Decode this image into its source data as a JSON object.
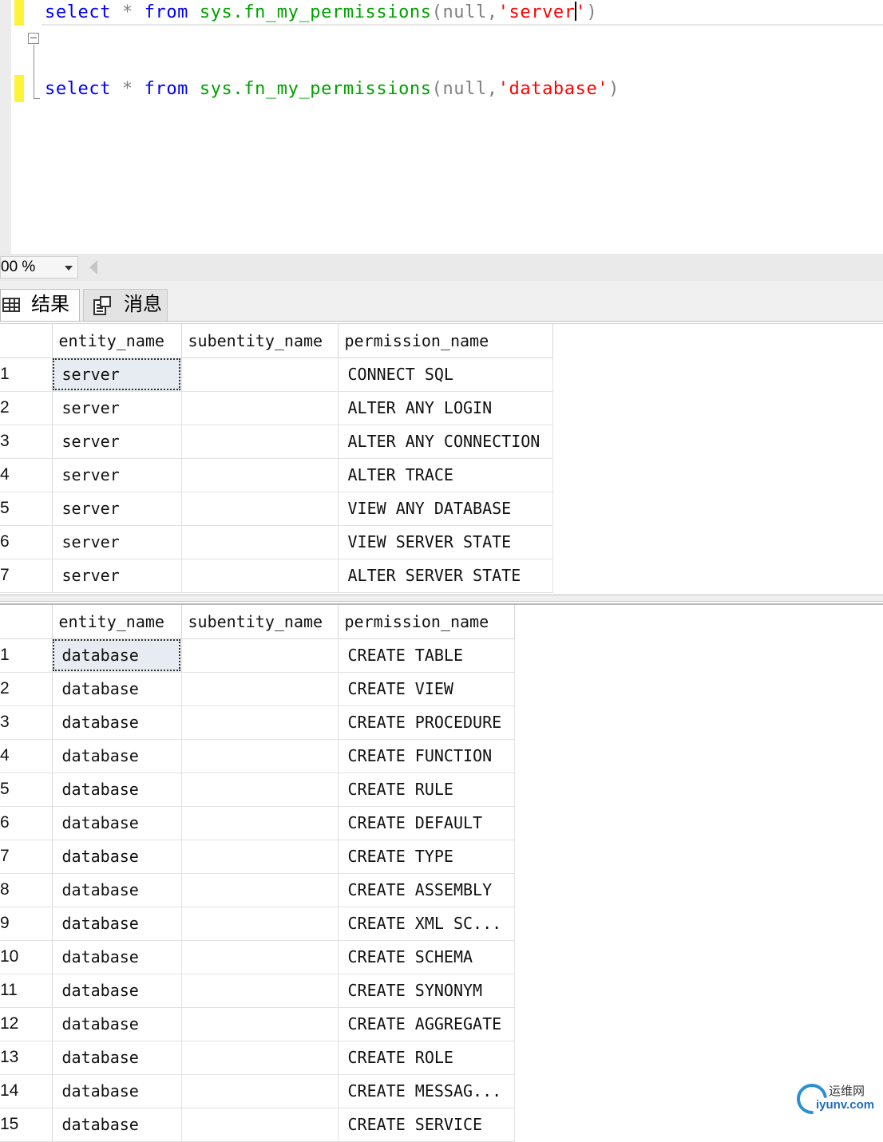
{
  "editor": {
    "line1": {
      "kw1": "select",
      "op": " * ",
      "kw2": "from",
      "fn": " sys.fn_my_permissions",
      "args_open": "(null,",
      "str_a": "'server",
      "str_b": "'",
      "close": ")"
    },
    "line2": {
      "kw1": "select",
      "op": " * ",
      "kw2": "from",
      "fn": " sys.fn_my_permissions",
      "args_open": "(null,",
      "str": "'database'",
      "close": ")"
    }
  },
  "zoom": {
    "value": "00 %"
  },
  "tabs": {
    "results": "结果",
    "messages": "消息"
  },
  "grid1": {
    "headers": [
      "entity_name",
      "subentity_name",
      "permission_name"
    ],
    "rows": [
      {
        "n": "1",
        "entity": "server",
        "sub": "",
        "perm": "CONNECT SQL"
      },
      {
        "n": "2",
        "entity": "server",
        "sub": "",
        "perm": "ALTER ANY LOGIN"
      },
      {
        "n": "3",
        "entity": "server",
        "sub": "",
        "perm": "ALTER ANY CONNECTION"
      },
      {
        "n": "4",
        "entity": "server",
        "sub": "",
        "perm": "ALTER TRACE"
      },
      {
        "n": "5",
        "entity": "server",
        "sub": "",
        "perm": "VIEW ANY DATABASE"
      },
      {
        "n": "6",
        "entity": "server",
        "sub": "",
        "perm": "VIEW SERVER STATE"
      },
      {
        "n": "7",
        "entity": "server",
        "sub": "",
        "perm": "ALTER SERVER STATE"
      }
    ]
  },
  "grid2": {
    "headers": [
      "entity_name",
      "subentity_name",
      "permission_name"
    ],
    "rows": [
      {
        "n": "1",
        "entity": "database",
        "sub": "",
        "perm": "CREATE TABLE"
      },
      {
        "n": "2",
        "entity": "database",
        "sub": "",
        "perm": "CREATE VIEW"
      },
      {
        "n": "3",
        "entity": "database",
        "sub": "",
        "perm": "CREATE PROCEDURE"
      },
      {
        "n": "4",
        "entity": "database",
        "sub": "",
        "perm": "CREATE FUNCTION"
      },
      {
        "n": "5",
        "entity": "database",
        "sub": "",
        "perm": "CREATE RULE"
      },
      {
        "n": "6",
        "entity": "database",
        "sub": "",
        "perm": "CREATE DEFAULT"
      },
      {
        "n": "7",
        "entity": "database",
        "sub": "",
        "perm": "CREATE TYPE"
      },
      {
        "n": "8",
        "entity": "database",
        "sub": "",
        "perm": "CREATE ASSEMBLY"
      },
      {
        "n": "9",
        "entity": "database",
        "sub": "",
        "perm": "CREATE XML SC..."
      },
      {
        "n": "10",
        "entity": "database",
        "sub": "",
        "perm": "CREATE SCHEMA"
      },
      {
        "n": "11",
        "entity": "database",
        "sub": "",
        "perm": "CREATE SYNONYM"
      },
      {
        "n": "12",
        "entity": "database",
        "sub": "",
        "perm": "CREATE AGGREGATE"
      },
      {
        "n": "13",
        "entity": "database",
        "sub": "",
        "perm": "CREATE ROLE"
      },
      {
        "n": "14",
        "entity": "database",
        "sub": "",
        "perm": "CREATE MESSAG..."
      },
      {
        "n": "15",
        "entity": "database",
        "sub": "",
        "perm": "CREATE SERVICE"
      }
    ]
  },
  "watermark": {
    "cn": "运维网",
    "en": "iyunv.com"
  }
}
